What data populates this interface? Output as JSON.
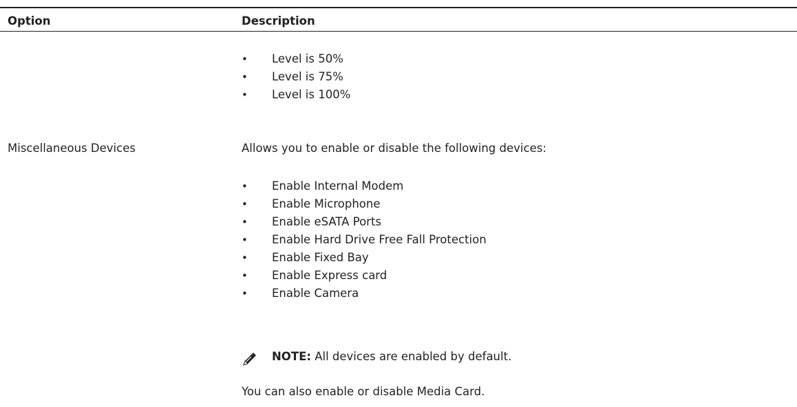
{
  "table": {
    "headers": {
      "option": "Option",
      "description": "Description"
    },
    "level_items": [
      "Level is 50%",
      "Level is 75%",
      "Level is 100%"
    ],
    "misc": {
      "option": "Miscellaneous Devices",
      "intro": "Allows you to enable or disable the following devices:",
      "items": [
        "Enable Internal Modem",
        "Enable Microphone",
        "Enable eSATA Ports",
        "Enable Hard Drive Free Fall Protection",
        "Enable Fixed Bay",
        "Enable Express card",
        "Enable Camera"
      ],
      "note_label": "NOTE:",
      "note_text": " All devices are enabled by default.",
      "note_icon": "pencil-note-icon",
      "footer": "You can also enable or disable Media Card."
    },
    "bullet": "•"
  }
}
